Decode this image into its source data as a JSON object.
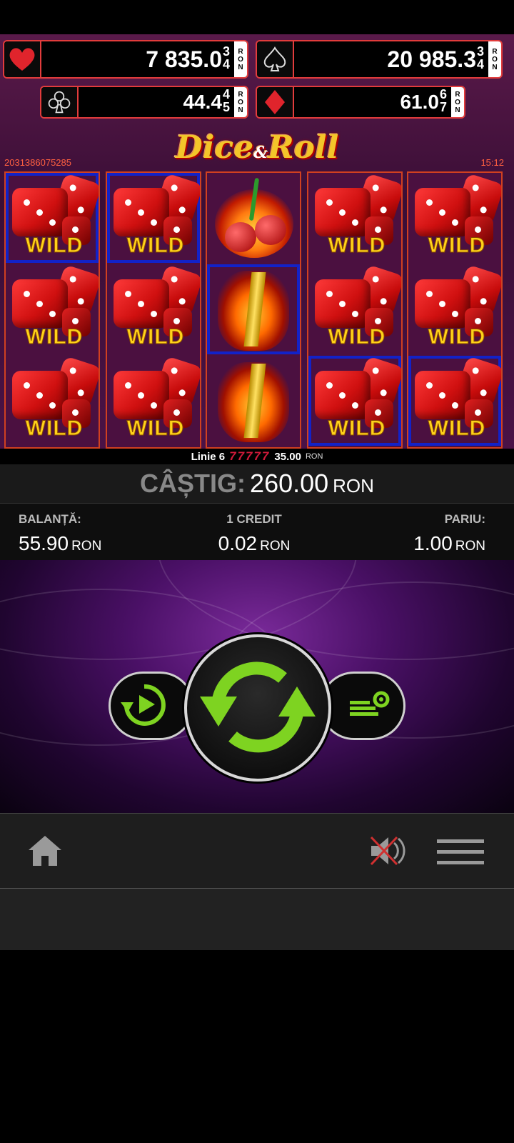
{
  "jackpots": {
    "heart": {
      "value": "7 835.0",
      "digits": [
        "3",
        "4"
      ],
      "currency": [
        "R",
        "O",
        "N"
      ]
    },
    "spade": {
      "value": "20 985.3",
      "digits": [
        "3",
        "4"
      ],
      "currency": [
        "R",
        "O",
        "N"
      ]
    },
    "club": {
      "value": "44.4",
      "digits": [
        "4",
        "5"
      ],
      "currency": [
        "R",
        "O",
        "N"
      ]
    },
    "diamond": {
      "value": "61.0",
      "digits": [
        "6",
        "7"
      ],
      "currency": [
        "R",
        "O",
        "N"
      ]
    }
  },
  "logo": {
    "word1": "Dice",
    "amp": "&",
    "word2": "Roll"
  },
  "ticket_id": "2031386075285",
  "clock": "15:12",
  "reels": [
    [
      "wild",
      "wild",
      "wild"
    ],
    [
      "wild",
      "wild",
      "wild"
    ],
    [
      "cherry",
      "seven",
      "seven"
    ],
    [
      "wild",
      "wild",
      "wild"
    ],
    [
      "wild",
      "wild",
      "wild"
    ]
  ],
  "symbol_labels": {
    "wild": "WILD"
  },
  "win_line": {
    "label": "Linie 6",
    "symbols": "77777",
    "amount": "35.00",
    "currency": "RON"
  },
  "win": {
    "label": "CÂȘTIG:",
    "amount": "260.00",
    "currency": "RON"
  },
  "info": {
    "balance": {
      "label": "BALANȚĂ:",
      "value": "55.90",
      "currency": "RON"
    },
    "credit": {
      "label": "1 CREDIT",
      "value": "0.02",
      "currency": "RON"
    },
    "bet": {
      "label": "PARIU:",
      "value": "1.00",
      "currency": "RON"
    }
  },
  "colors": {
    "accent_green": "#7ed321",
    "jackpot_border": "#e23c3c",
    "highlight": "#1222c8"
  },
  "icons": {
    "left": "autoplay-icon",
    "center": "spin-icon",
    "right": "bet-settings-icon",
    "home": "home-icon",
    "sound": "sound-muted-icon",
    "menu": "menu-icon"
  }
}
